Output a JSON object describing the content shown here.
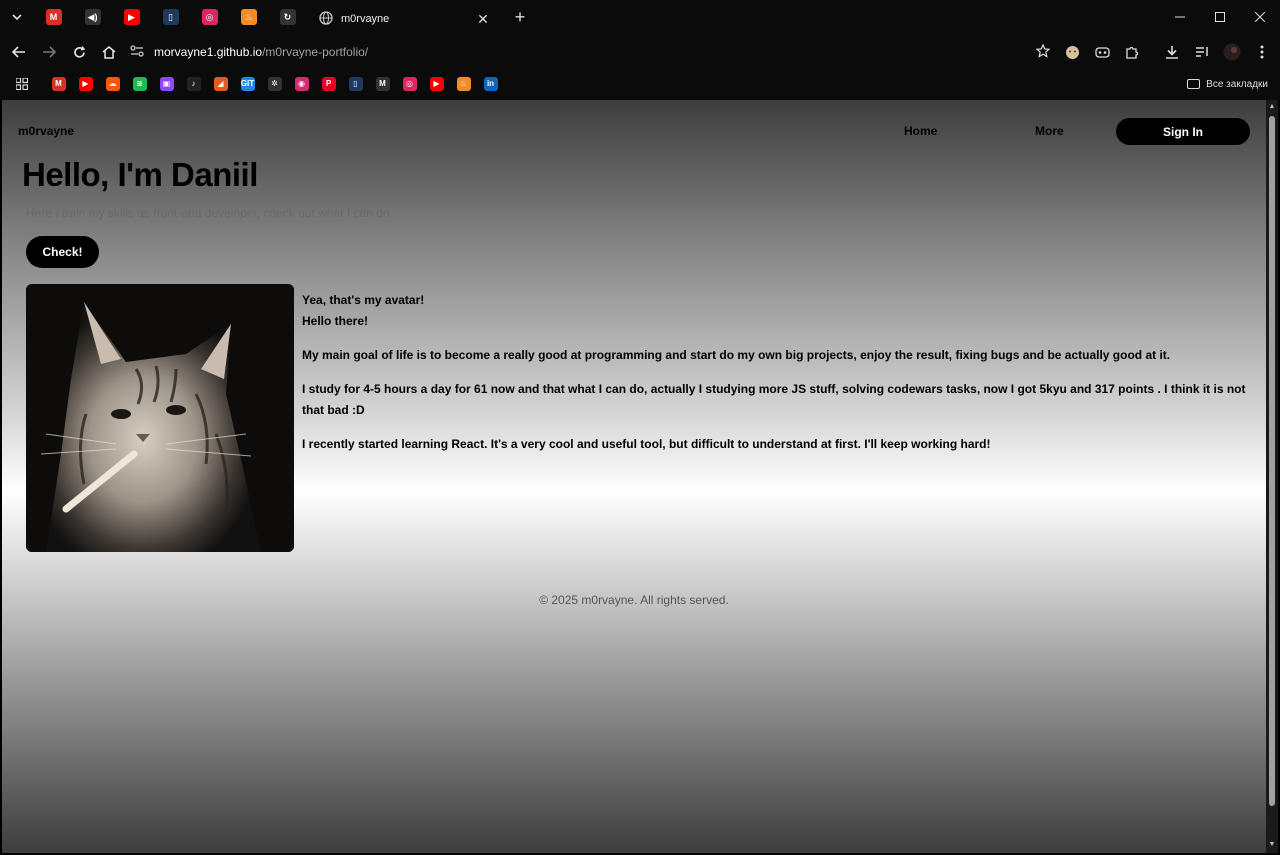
{
  "browser": {
    "pinned_tabs": [
      {
        "icon": "gmail-icon",
        "glyph": "M",
        "color": "#d93025"
      },
      {
        "icon": "speaker-icon",
        "glyph": "◀)",
        "color": "#333333"
      },
      {
        "icon": "youtube-icon",
        "glyph": "▶",
        "color": "#ff0000"
      },
      {
        "icon": "page-icon",
        "glyph": "▯",
        "color": "#1e3a5f"
      },
      {
        "icon": "shield-icon",
        "glyph": "◎",
        "color": "#e0245e"
      },
      {
        "icon": "fire-icon",
        "glyph": "♨",
        "color": "#f28c28"
      },
      {
        "icon": "sync-icon",
        "glyph": "↻",
        "color": "#333333"
      }
    ],
    "active_tab": {
      "title": "m0rvayne",
      "icon": "globe-icon"
    },
    "url": {
      "host": "morvayne1.github.io",
      "path": "/m0rvayne-portfolio/"
    },
    "bookmarks": [
      {
        "icon": "gmail-icon",
        "glyph": "M",
        "color": "#d93025"
      },
      {
        "icon": "youtube-icon",
        "glyph": "▶",
        "color": "#ff0000"
      },
      {
        "icon": "soundcloud-icon",
        "glyph": "☁",
        "color": "#ff5500"
      },
      {
        "icon": "spotify-icon",
        "glyph": "≋",
        "color": "#1db954"
      },
      {
        "icon": "twitch-icon",
        "glyph": "▣",
        "color": "#9146ff"
      },
      {
        "icon": "tiktok-icon",
        "glyph": "♪",
        "color": "#222222"
      },
      {
        "icon": "arrow-icon",
        "glyph": "◢",
        "color": "#e35b1f"
      },
      {
        "icon": "git-icon",
        "glyph": "GIT",
        "color": "#1e88e5"
      },
      {
        "icon": "openai-icon",
        "glyph": "✲",
        "color": "#333333"
      },
      {
        "icon": "instagram-icon",
        "glyph": "◉",
        "color": "#d62976"
      },
      {
        "icon": "pinterest-icon",
        "glyph": "P",
        "color": "#e60023"
      },
      {
        "icon": "page-icon",
        "glyph": "▯",
        "color": "#1e3a5f"
      },
      {
        "icon": "medium-icon",
        "glyph": "M",
        "color": "#333333"
      },
      {
        "icon": "shield-icon",
        "glyph": "◎",
        "color": "#e0245e"
      },
      {
        "icon": "youtube-icon",
        "glyph": "▶",
        "color": "#ff0000"
      },
      {
        "icon": "fire-icon",
        "glyph": "♨",
        "color": "#f28c28"
      },
      {
        "icon": "linkedin-icon",
        "glyph": "in",
        "color": "#0a66c2"
      }
    ],
    "all_bookmarks_label": "Все закладки"
  },
  "site": {
    "logo": "m0rvayne",
    "nav": {
      "home": "Home",
      "more": "More",
      "signin": "Sign In"
    },
    "hero": {
      "title": "Hello, I'm Daniil",
      "subtitle": "Here I train my skills as front-end developer, check out what I can do.",
      "button": "Check!"
    },
    "about": {
      "p1": "Yea, that's my avatar!",
      "p2": "Hello there!",
      "p3": "My main goal of life is to become a really good at programming and start do my own big projects, enjoy the result, fixing bugs and be actually good at it.",
      "p4": "I study for 4-5 hours a day for 61 now and that what I can do, actually I studying more JS stuff, solving codewars tasks, now I got 5kyu and 317 points . I think it is not that bad :D",
      "p5": "I recently started learning React. It's a very cool and useful tool, but difficult to understand at first. I'll keep working hard!"
    },
    "footer": "© 2025 m0rvayne. All rights served."
  }
}
